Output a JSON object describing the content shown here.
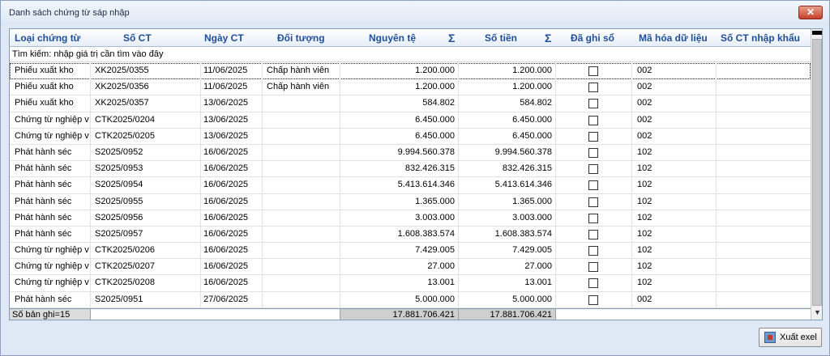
{
  "window": {
    "title": "Danh sách chứng từ sáp nhập",
    "close_label": "✕"
  },
  "grid": {
    "headers": {
      "loai": "Loại chứng từ",
      "so_ct": "Số CT",
      "ngay_ct": "Ngày CT",
      "doi_tuong": "Đối tượng",
      "nguyen_te": "Nguyên tệ",
      "nguyen_te_sum": "Σ",
      "so_tien": "Số tiền",
      "so_tien_sum": "Σ",
      "da_ghi_so": "Đã ghi sổ",
      "ma_hoa": "Mã hóa dữ liệu",
      "so_ct_nk": "Số CT nhập khẩu"
    },
    "search_placeholder": "Tìm kiếm: nhập giá trị cần tìm vào đây",
    "rows": [
      {
        "loai": "Phiếu xuất kho",
        "so_ct": "XK2025/0355",
        "ngay": "11/06/2025",
        "doi_tuong": "Chấp hành viên",
        "nguyen_te": "1.200.000",
        "so_tien": "1.200.000",
        "ma_hoa": "002"
      },
      {
        "loai": "Phiếu xuất kho",
        "so_ct": "XK2025/0356",
        "ngay": "11/06/2025",
        "doi_tuong": "Chấp hành viên",
        "nguyen_te": "1.200.000",
        "so_tien": "1.200.000",
        "ma_hoa": "002"
      },
      {
        "loai": "Phiếu xuất kho",
        "so_ct": "XK2025/0357",
        "ngay": "13/06/2025",
        "doi_tuong": "",
        "nguyen_te": "584.802",
        "so_tien": "584.802",
        "ma_hoa": "002"
      },
      {
        "loai": "Chứng từ nghiệp v",
        "so_ct": "CTK2025/0204",
        "ngay": "13/06/2025",
        "doi_tuong": "",
        "nguyen_te": "6.450.000",
        "so_tien": "6.450.000",
        "ma_hoa": "002"
      },
      {
        "loai": "Chứng từ nghiệp v",
        "so_ct": "CTK2025/0205",
        "ngay": "13/06/2025",
        "doi_tuong": "",
        "nguyen_te": "6.450.000",
        "so_tien": "6.450.000",
        "ma_hoa": "002"
      },
      {
        "loai": "Phát hành séc",
        "so_ct": "S2025/0952",
        "ngay": "16/06/2025",
        "doi_tuong": "",
        "nguyen_te": "9.994.560.378",
        "so_tien": "9.994.560.378",
        "ma_hoa": "102"
      },
      {
        "loai": "Phát hành séc",
        "so_ct": "S2025/0953",
        "ngay": "16/06/2025",
        "doi_tuong": "",
        "nguyen_te": "832.426.315",
        "so_tien": "832.426.315",
        "ma_hoa": "102"
      },
      {
        "loai": "Phát hành séc",
        "so_ct": "S2025/0954",
        "ngay": "16/06/2025",
        "doi_tuong": "",
        "nguyen_te": "5.413.614.346",
        "so_tien": "5.413.614.346",
        "ma_hoa": "102"
      },
      {
        "loai": "Phát hành séc",
        "so_ct": "S2025/0955",
        "ngay": "16/06/2025",
        "doi_tuong": "",
        "nguyen_te": "1.365.000",
        "so_tien": "1.365.000",
        "ma_hoa": "102"
      },
      {
        "loai": "Phát hành séc",
        "so_ct": "S2025/0956",
        "ngay": "16/06/2025",
        "doi_tuong": "",
        "nguyen_te": "3.003.000",
        "so_tien": "3.003.000",
        "ma_hoa": "102"
      },
      {
        "loai": "Phát hành séc",
        "so_ct": "S2025/0957",
        "ngay": "16/06/2025",
        "doi_tuong": "",
        "nguyen_te": "1.608.383.574",
        "so_tien": "1.608.383.574",
        "ma_hoa": "102"
      },
      {
        "loai": "Chứng từ nghiệp v",
        "so_ct": "CTK2025/0206",
        "ngay": "16/06/2025",
        "doi_tuong": "",
        "nguyen_te": "7.429.005",
        "so_tien": "7.429.005",
        "ma_hoa": "102"
      },
      {
        "loai": "Chứng từ nghiệp v",
        "so_ct": "CTK2025/0207",
        "ngay": "16/06/2025",
        "doi_tuong": "",
        "nguyen_te": "27.000",
        "so_tien": "27.000",
        "ma_hoa": "102"
      },
      {
        "loai": "Chứng từ nghiệp v",
        "so_ct": "CTK2025/0208",
        "ngay": "16/06/2025",
        "doi_tuong": "",
        "nguyen_te": "13.001",
        "so_tien": "13.001",
        "ma_hoa": "102"
      },
      {
        "loai": "Phát hành séc",
        "so_ct": "S2025/0951",
        "ngay": "27/06/2025",
        "doi_tuong": "",
        "nguyen_te": "5.000.000",
        "so_tien": "5.000.000",
        "ma_hoa": "002"
      }
    ],
    "footer": {
      "record_count": "Số bản ghi=15",
      "total_nguyen_te": "17.881.706.421",
      "total_so_tien": "17.881.706.421"
    }
  },
  "buttons": {
    "export_label": "Xuất exel"
  }
}
